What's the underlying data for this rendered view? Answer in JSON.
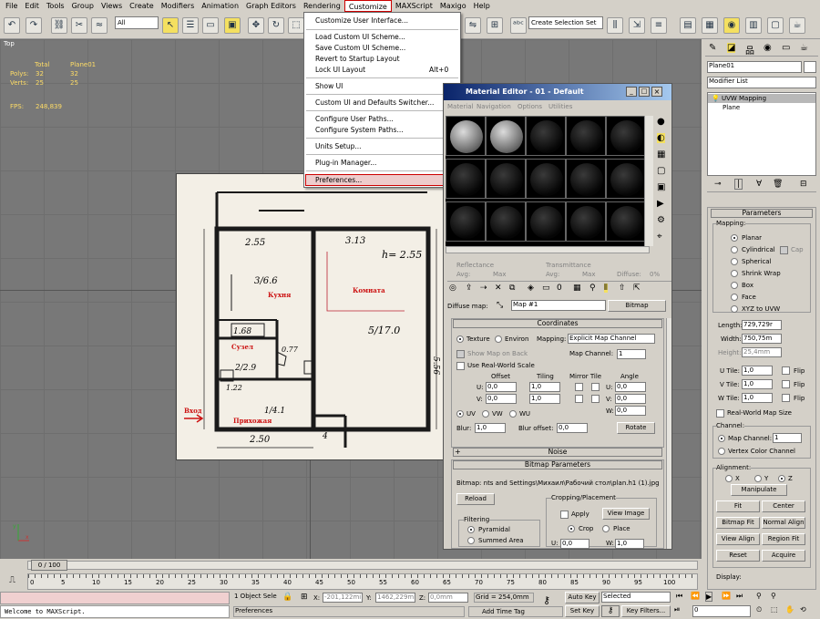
{
  "menubar": {
    "items": [
      "File",
      "Edit",
      "Tools",
      "Group",
      "Views",
      "Create",
      "Modifiers",
      "Animation",
      "Graph Editors",
      "Rendering",
      "Customize",
      "MAXScript",
      "Maxigo",
      "Help"
    ],
    "active": "Customize"
  },
  "toolbar": {
    "filter_value": "All",
    "selection_set_placeholder": "Create Selection Set"
  },
  "viewport": {
    "label": "Top",
    "stats": {
      "header_total": "Total",
      "header_object": "Plane01",
      "polys_label": "Polys:",
      "polys_total": "32",
      "polys_object": "32",
      "verts_label": "Verts:",
      "verts_total": "25",
      "verts_object": "25",
      "fps_label": "FPS:",
      "fps_value": "248,839"
    }
  },
  "customize_menu": {
    "items": [
      "Customize User Interface...",
      "Load Custom UI Scheme...",
      "Save Custom UI Scheme...",
      "Revert to Startup Layout",
      "Lock UI Layout",
      "Show UI",
      "Custom UI and Defaults Switcher...",
      "Configure User Paths...",
      "Configure System Paths...",
      "Units Setup...",
      "Plug-in Manager...",
      "Preferences..."
    ],
    "lock_shortcut": "Alt+0",
    "highlighted": "Preferences..."
  },
  "plan": {
    "texts": [
      "2.55",
      "3.13",
      "h= 2.55",
      "3/6.6",
      "Кухня",
      "Комната",
      "5/17.0",
      "1.68",
      "Сузел",
      "2/2.9",
      "1.22",
      "0.77",
      "1/4.1",
      "Прихожая",
      "Вход",
      "2.50",
      "4",
      "5.56"
    ]
  },
  "material_editor": {
    "title": "Material Editor - 01 - Default",
    "menu": [
      "Material",
      "Navigation",
      "Options",
      "Utilities"
    ],
    "reflectance_label": "Reflectance",
    "transmittance_label": "Transmittance",
    "avg_label": "Avg:",
    "max_label": "Max",
    "diffuse_label": "Diffuse:",
    "diffuse_value": "0%",
    "diffuse_map_label": "Diffuse map:",
    "diffuse_map_value": "Map #1",
    "diffuse_map_type": "Bitmap",
    "coordinates": {
      "title": "Coordinates",
      "texture_label": "Texture",
      "environ_label": "Environ",
      "mapping_label": "Mapping:",
      "mapping_value": "Explicit Map Channel",
      "show_map_on_back": "Show Map on Back",
      "map_channel_label": "Map Channel:",
      "map_channel_value": "1",
      "use_real_world": "Use Real-World Scale",
      "offset_label": "Offset",
      "tiling_label": "Tiling",
      "mirror_tile_label": "Mirror Tile",
      "angle_label": "Angle",
      "u_label": "U:",
      "v_label": "V:",
      "w_label": "W:",
      "u_offset": "0,0",
      "v_offset": "0,0",
      "u_tiling": "1,0",
      "v_tiling": "1,0",
      "u_angle": "0,0",
      "v_angle": "0,0",
      "w_angle": "0,0",
      "uv": "UV",
      "vw": "VW",
      "wu": "WU",
      "blur_label": "Blur:",
      "blur_value": "1,0",
      "blur_offset_label": "Blur offset:",
      "blur_offset_value": "0,0",
      "rotate_button": "Rotate"
    },
    "noise_title": "Noise",
    "bitmap_params": {
      "title": "Bitmap Parameters",
      "bitmap_path": "Bitmap: nts and Settings\\Михаил\\Рабочий стол\\plan.h1 (1).jpg",
      "reload_button": "Reload",
      "cropping_title": "Cropping/Placement",
      "apply_label": "Apply",
      "view_image_button": "View Image",
      "crop_label": "Crop",
      "place_label": "Place",
      "filtering_title": "Filtering",
      "pyramidal": "Pyramidal",
      "summed_area": "Summed Area",
      "u_value": "0,0",
      "w_value": "1,0"
    }
  },
  "command_panel": {
    "object_name": "Plane01",
    "modifier_list": "Modifier List",
    "stack": [
      "UVW Mapping",
      "Plane"
    ],
    "parameters": {
      "title": "Parameters",
      "mapping_title": "Mapping:",
      "options": [
        "Planar",
        "Cylindrical",
        "Spherical",
        "Shrink Wrap",
        "Box",
        "Face",
        "XYZ to UVW"
      ],
      "cap_label": "Cap",
      "length_label": "Length:",
      "length_value": "729,729r",
      "width_label": "Width:",
      "width_value": "750,75m",
      "height_label": "Height:",
      "height_value": "25,4mm",
      "u_tile_label": "U Tile:",
      "u_tile_value": "1,0",
      "v_tile_label": "V Tile:",
      "v_tile_value": "1,0",
      "w_tile_label": "W Tile:",
      "w_tile_value": "1,0",
      "flip_label": "Flip",
      "real_world": "Real-World Map Size",
      "channel_title": "Channel:",
      "map_channel_label": "Map Channel:",
      "map_channel_value": "1",
      "vertex_color_channel": "Vertex Color Channel",
      "alignment_title": "Alignment:",
      "x_label": "X",
      "y_label": "Y",
      "z_label": "Z",
      "buttons": [
        "Manipulate",
        "Fit",
        "Center",
        "Bitmap Fit",
        "Normal Align",
        "View Align",
        "Region Fit",
        "Reset",
        "Acquire"
      ],
      "display_title": "Display:"
    }
  },
  "timeline": {
    "frame_label": "0 / 100",
    "ticks": [
      "0",
      "5",
      "10",
      "15",
      "20",
      "25",
      "30",
      "35",
      "40",
      "45",
      "50",
      "55",
      "60",
      "65",
      "70",
      "75",
      "80",
      "85",
      "90",
      "95",
      "100"
    ]
  },
  "status": {
    "maxscript": "Welcome to MAXScript.",
    "selected": "1 Object Sele",
    "x_label": "X:",
    "x_value": "-201,122mi",
    "y_label": "Y:",
    "y_value": "1462,229mi",
    "z_label": "Z:",
    "z_value": "0,0mm",
    "grid": "Grid = 254,0mm",
    "auto_key": "Auto Key",
    "set_key": "Set Key",
    "selected_dropdown": "Selected",
    "key_filters": "Key Filters...",
    "add_time_tag": "Add Time Tag",
    "prompt": "Preferences",
    "frame_value": "0"
  }
}
